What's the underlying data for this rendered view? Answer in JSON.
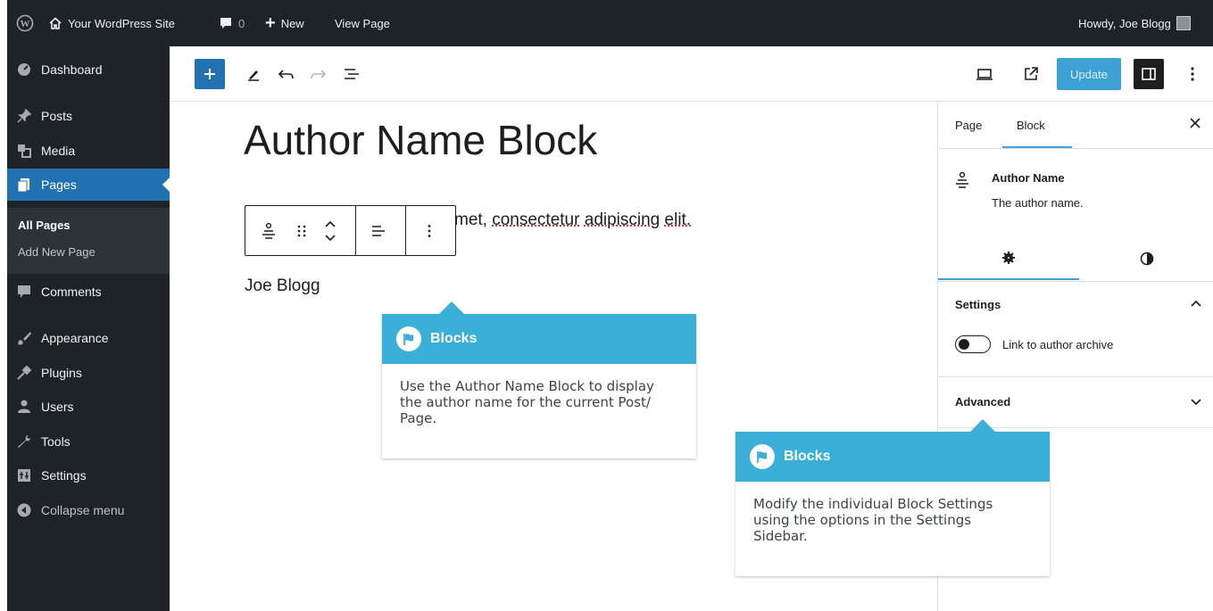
{
  "adminbar": {
    "site_name": "Your WordPress Site",
    "comments_count": "0",
    "new_label": "New",
    "view_page_label": "View Page",
    "howdy": "Howdy, Joe Blogg"
  },
  "sidebar": {
    "items": [
      {
        "label": "Dashboard",
        "icon": "dashboard-icon"
      },
      {
        "label": "Posts",
        "icon": "pin-icon"
      },
      {
        "label": "Media",
        "icon": "media-icon"
      },
      {
        "label": "Pages",
        "icon": "pages-icon"
      },
      {
        "label": "Comments",
        "icon": "comment-icon"
      },
      {
        "label": "Appearance",
        "icon": "brush-icon"
      },
      {
        "label": "Plugins",
        "icon": "plug-icon"
      },
      {
        "label": "Users",
        "icon": "users-icon"
      },
      {
        "label": "Tools",
        "icon": "wrench-icon"
      },
      {
        "label": "Settings",
        "icon": "settings-icon"
      },
      {
        "label": "Collapse menu",
        "icon": "collapse-icon"
      }
    ],
    "submenu": [
      "All Pages",
      "Add New Page"
    ]
  },
  "toolbar": {
    "update_label": "Update"
  },
  "editor": {
    "title": "Author Name Block",
    "paragraph_text": "met, consectetur adipiscing elit.",
    "paragraph_words": [
      "met,",
      "consectetur",
      "adipiscing",
      "elit."
    ],
    "author_name": "Joe Blogg"
  },
  "settings_sidebar": {
    "tab_page": "Page",
    "tab_block": "Block",
    "block_name": "Author Name",
    "block_description": "The author name.",
    "settings_heading": "Settings",
    "toggle_label": "Link to author archive",
    "toggle_on": false,
    "advanced_heading": "Advanced"
  },
  "callouts": [
    {
      "title": "Blocks",
      "text_lines": [
        "Use the Author Name Block to display",
        "the author name for the current Post/",
        "Page."
      ]
    },
    {
      "title": "Blocks",
      "text_lines": [
        "Modify the individual Block Settings",
        "using the options in the Settings",
        "Sidebar."
      ]
    }
  ],
  "colors": {
    "admin_bg": "#1d2327",
    "accent": "#2271b1",
    "update_button": "#3ea1d6",
    "callout_head": "#3aafd8"
  }
}
